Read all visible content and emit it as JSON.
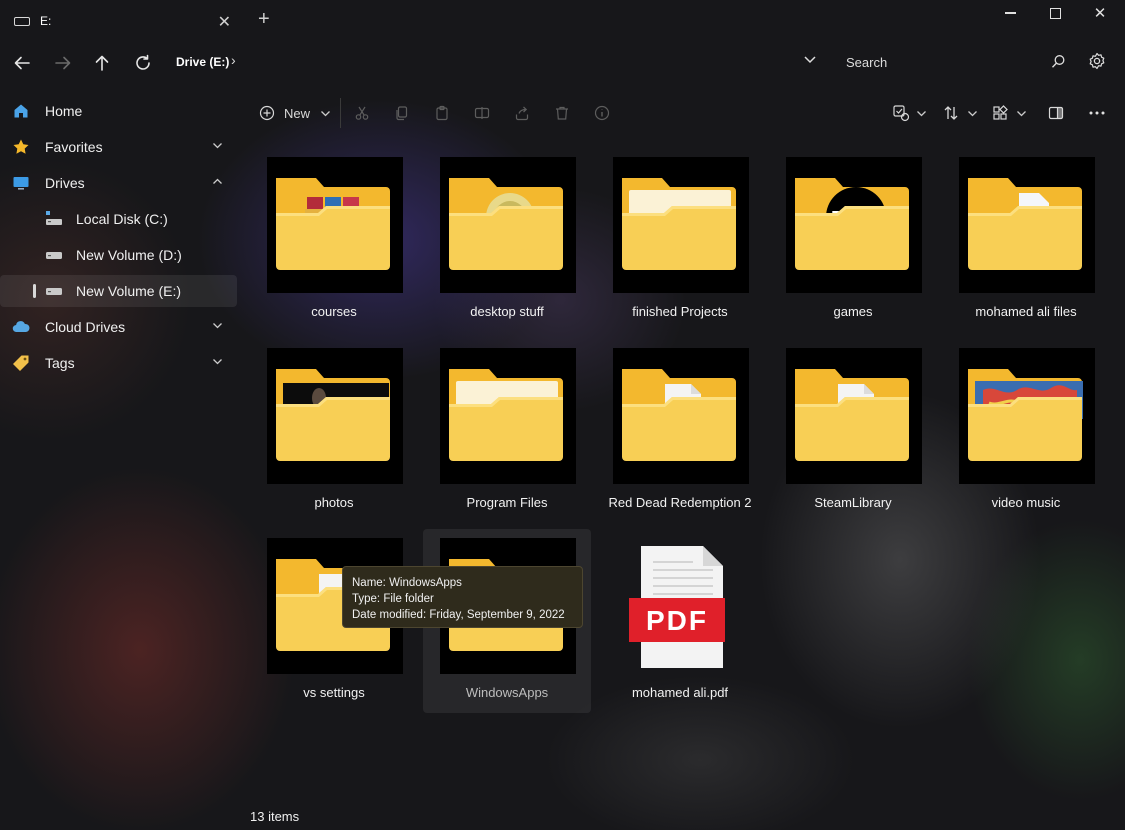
{
  "window": {
    "tab_title": "E:"
  },
  "nav": {
    "breadcrumb": "Drive (E:)",
    "search_placeholder": "Search"
  },
  "sidebar": {
    "items": [
      {
        "label": "Home"
      },
      {
        "label": "Favorites"
      },
      {
        "label": "Drives"
      },
      {
        "label": "Local Disk (C:)"
      },
      {
        "label": "New Volume (D:)"
      },
      {
        "label": "New Volume (E:)"
      },
      {
        "label": "Cloud Drives"
      },
      {
        "label": "Tags"
      }
    ]
  },
  "toolbar": {
    "new_label": "New"
  },
  "files": [
    {
      "name": "courses",
      "icon": "winrar-folder"
    },
    {
      "name": "desktop stuff",
      "icon": "disc-folder"
    },
    {
      "name": "finished Projects",
      "icon": "empty-folder"
    },
    {
      "name": "games",
      "icon": "logo-folder"
    },
    {
      "name": "mohamed ali files",
      "icon": "word-folder"
    },
    {
      "name": "photos",
      "icon": "image-folder"
    },
    {
      "name": "Program Files",
      "icon": "empty-folder"
    },
    {
      "name": "Red Dead Redemption 2",
      "icon": "document-folder"
    },
    {
      "name": "SteamLibrary",
      "icon": "document-folder"
    },
    {
      "name": "video music",
      "icon": "art-folder"
    },
    {
      "name": "vs settings",
      "icon": "document-folder"
    },
    {
      "name": "WindowsApps",
      "icon": "empty-folder"
    },
    {
      "name": "mohamed ali.pdf",
      "icon": "pdf-file",
      "badge": "PDF"
    }
  ],
  "tooltip": {
    "name": "Name: WindowsApps",
    "type": "Type: File folder",
    "modified": "Date modified: Friday, September 9, 2022"
  },
  "status": {
    "count": "13 items"
  },
  "colors": {
    "folder": "#f8cf55",
    "folder_back": "#f3b82e",
    "pdf_red": "#e0202a",
    "background": "#141416"
  }
}
